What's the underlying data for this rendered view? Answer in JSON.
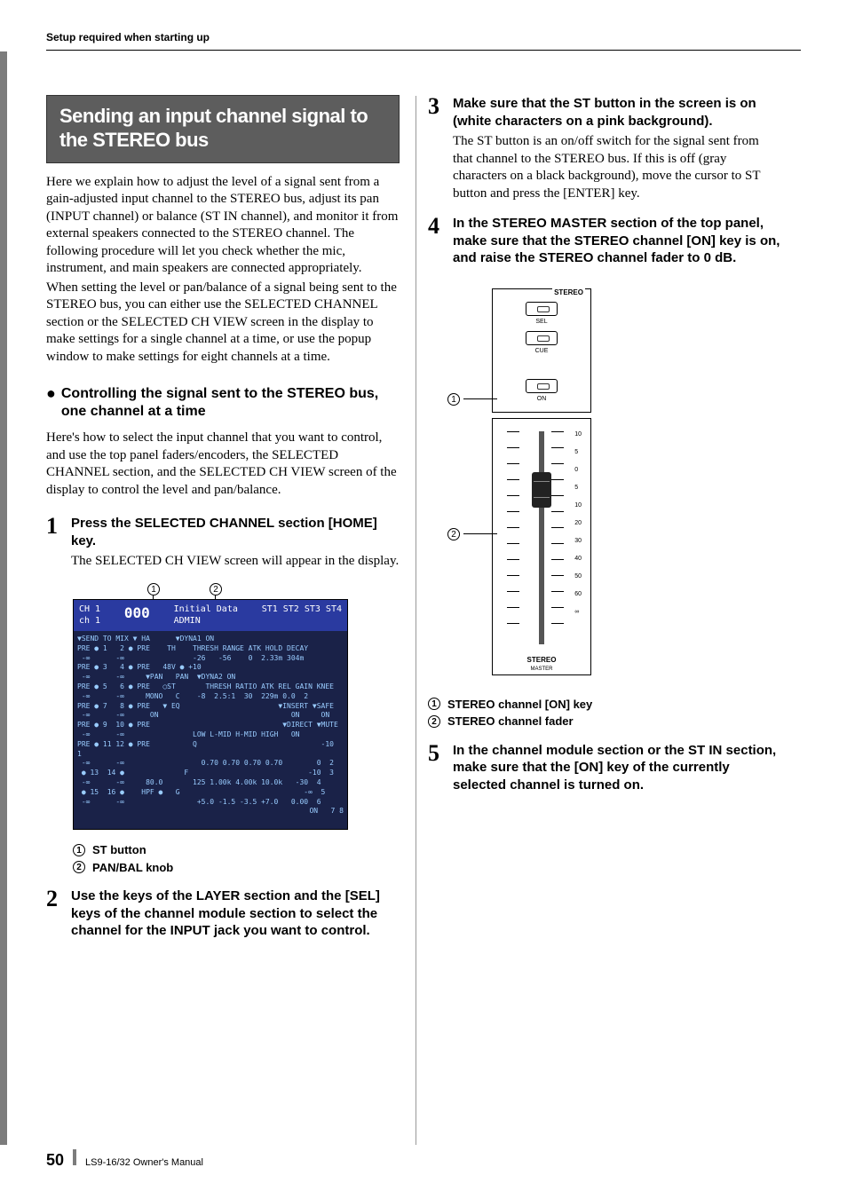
{
  "header": {
    "running": "Setup required when starting up"
  },
  "section": {
    "title": "Sending an input channel signal to the STEREO bus",
    "intro1": "Here we explain how to adjust the level of a signal sent from a gain-adjusted input channel to the STEREO bus, adjust its pan (INPUT channel) or balance (ST IN channel), and monitor it from external speakers connected to the STEREO channel. The following procedure will let you check whether the mic, instrument, and main speakers are connected appropriately.",
    "intro2": "When setting the level or pan/balance of a signal being sent to the STEREO bus, you can either use the SELECTED CHANNEL section or the SELECTED CH VIEW screen in the display to make settings for a single channel at a time, or use the popup window to make settings for eight channels at a time."
  },
  "subhead": "Controlling the signal sent to the STEREO bus, one channel at a time",
  "subhead_text": "Here's how to select the input channel that you want to control, and use the top panel faders/encoders, the SELECTED CHANNEL section, and the SELECTED CH VIEW screen of the display to control the level and pan/balance.",
  "steps": {
    "s1": {
      "num": "1",
      "title": "Press the SELECTED CHANNEL section [HOME] key.",
      "text": "The SELECTED CH VIEW screen will appear in the display."
    },
    "s2": {
      "num": "2",
      "title": "Use the keys of the LAYER section and the [SEL] keys of the channel module section to select the channel for the INPUT jack you want to control."
    },
    "s3": {
      "num": "3",
      "title": "Make sure that the ST button in the screen is on (white characters on a pink background).",
      "text": "The ST button is an on/off switch for the signal sent from that channel to the STEREO bus. If this is off (gray characters on a black background), move the cursor to ST button and press the [ENTER] key."
    },
    "s4": {
      "num": "4",
      "title": "In the STEREO MASTER section of the top panel, make sure that the STEREO channel [ON] key is on, and raise the STEREO channel fader to 0 dB."
    },
    "s5": {
      "num": "5",
      "title": "In the channel module section or the ST IN section, make sure that the [ON] key of the currently selected channel is turned on."
    }
  },
  "fig1": {
    "callout1": "1",
    "callout2": "2",
    "topbar_left": "CH 1",
    "topbar_ch": "ch 1",
    "topbar_num": "000",
    "topbar_mid": "Initial Data",
    "topbar_admin": "ADMIN",
    "legend1": "ST button",
    "legend2": "PAN/BAL knob"
  },
  "fig2": {
    "stereo_label": "STEREO",
    "sel": "SEL",
    "cue": "CUE",
    "on": "ON",
    "master": "MASTER",
    "scale": [
      "10",
      "5",
      "0",
      "5",
      "10",
      "20",
      "30",
      "40",
      "50",
      "60",
      "∞"
    ],
    "legend1": "STEREO channel [ON] key",
    "legend2": "STEREO channel fader"
  },
  "footer": {
    "page": "50",
    "manual": "LS9-16/32  Owner's Manual"
  }
}
